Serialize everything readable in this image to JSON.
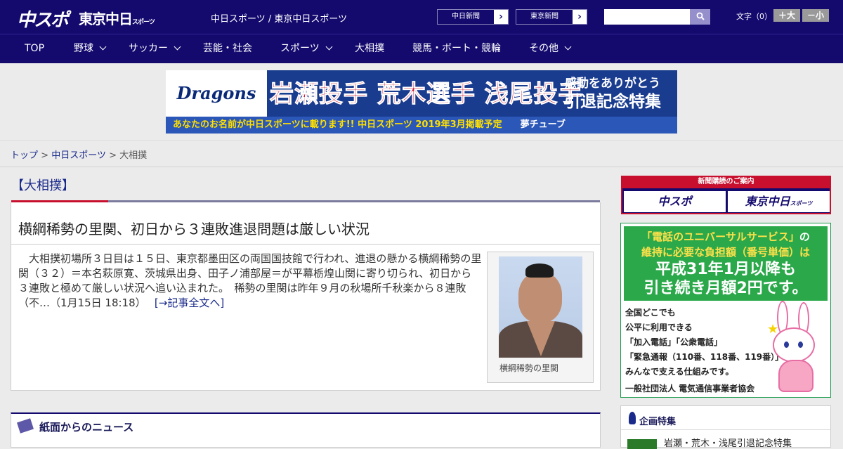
{
  "header": {
    "logo_main": "中スポ",
    "logo_tokyo": "東京中日",
    "logo_tokyo_small": "スポーツ",
    "site_name": "中日スポーツ / 東京中日スポーツ",
    "paper_links": [
      {
        "label": "中日新聞",
        "arrow": "›"
      },
      {
        "label": "東京新聞",
        "arrow": "›"
      }
    ],
    "search": {
      "placeholder": "",
      "button_icon": "search-icon"
    },
    "font_size_label": "文字（0）",
    "font_bigger": "＋大",
    "font_smaller": "－小"
  },
  "nav": {
    "items": [
      {
        "label": "TOP",
        "has_menu": false
      },
      {
        "label": "野球",
        "has_menu": true
      },
      {
        "label": "サッカー",
        "has_menu": true
      },
      {
        "label": "芸能・社会",
        "has_menu": false
      },
      {
        "label": "スポーツ",
        "has_menu": true
      },
      {
        "label": "大相撲",
        "has_menu": false
      },
      {
        "label": "競馬・ボート・競輪",
        "has_menu": false
      },
      {
        "label": "その他",
        "has_menu": true
      }
    ]
  },
  "banner": {
    "team": "Dragons",
    "names": "岩瀬投手 荒木選手 浅尾投手",
    "thanks_line1": "感動をありがとう",
    "thanks_line2": "引退記念特集",
    "strip_text": "あなたのお名前が中日スポーツに載ります!! 中日スポーツ 2019年3月掲載予定",
    "strip_brand": "夢チューブ"
  },
  "breadcrumb": {
    "items": [
      "トップ",
      "中日スポーツ",
      "大相撲"
    ],
    "separator": ">"
  },
  "article": {
    "category": "【大相撲】",
    "title": "横綱稀勢の里関、初日から３連敗進退問題は厳しい状況",
    "body": "　大相撲初場所３日目は１５日、東京都墨田区の両国国技館で行われ、進退の懸かる横綱稀勢の里関（３２）＝本名萩原寛、茨城県出身、田子ノ浦部屋＝が平幕栃煌山関に寄り切られ、初日から３連敗と極めて厳しい状況へ追い込まれた。　稀勢の里関は昨年９月の秋場所千秋楽から８連敗（不…（1月15日 18:18）",
    "more_link": "[→記事全文へ]",
    "photo_caption": "横綱稀勢の里関"
  },
  "news_section": {
    "title": "紙面からのニュース"
  },
  "sidebar": {
    "subscribe": {
      "header": "新聞購読のご案内",
      "button1": "中スポ",
      "button2": "東京中日",
      "button2_small": "スポーツ"
    },
    "ad": {
      "line1_a": "「電話のユニバーサルサービス」",
      "line1_b": "の",
      "line2": "維持に必要な負担額（番号単価）は",
      "line3": "平成31年1月以降も",
      "line4": "引き続き月額2円です。",
      "lines": [
        "全国どこでも",
        "公平に利用できる",
        "「加入電話」「公衆電話」",
        "「緊急通報（110番、118番、119番）」を",
        "みんなで支える仕組みです。"
      ],
      "footer": "一般社団法人 電気通信事業者協会"
    },
    "features": {
      "title": "企画特集",
      "items": [
        "岩瀬・荒木・浅尾引退記念特集"
      ]
    }
  }
}
